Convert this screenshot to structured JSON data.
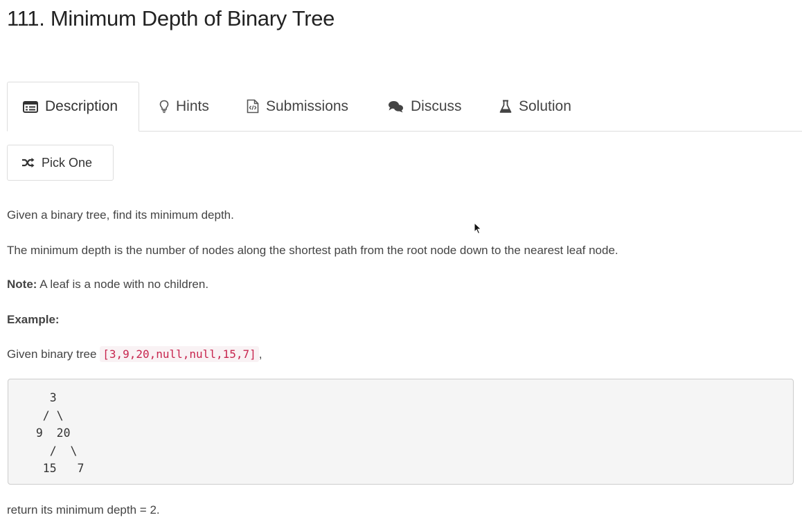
{
  "title": "111. Minimum Depth of Binary Tree",
  "tabs": [
    {
      "label": "Description",
      "icon": "description-icon",
      "active": true
    },
    {
      "label": "Hints",
      "icon": "lightbulb-icon",
      "active": false
    },
    {
      "label": "Submissions",
      "icon": "code-file-icon",
      "active": false
    },
    {
      "label": "Discuss",
      "icon": "comments-icon",
      "active": false
    },
    {
      "label": "Solution",
      "icon": "flask-icon",
      "active": false
    }
  ],
  "pick_one": {
    "label": "Pick One",
    "icon": "shuffle-icon"
  },
  "description": {
    "p1": "Given a binary tree, find its minimum depth.",
    "p2": "The minimum depth is the number of nodes along the shortest path from the root node down to the nearest leaf node.",
    "note_label": "Note:",
    "note_text": " A leaf is a node with no children.",
    "example_label": "Example:",
    "given_prefix": "Given binary tree ",
    "given_code": "[3,9,20,null,null,15,7]",
    "given_suffix": ",",
    "tree_lines": [
      "    3",
      "   / \\",
      "  9  20",
      "    /  \\",
      "   15   7"
    ],
    "result": "return its minimum depth = 2."
  },
  "colors": {
    "code_text": "#c7254e",
    "code_bg": "#f9f2f4",
    "pre_bg": "#f5f5f5"
  }
}
